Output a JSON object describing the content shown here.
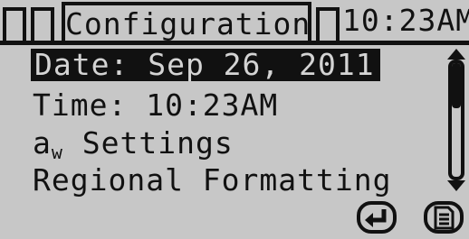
{
  "header": {
    "title": "Configuration",
    "clock": "10:23AM"
  },
  "menu": {
    "items": [
      {
        "label": "Date: Sep 26, 2011",
        "selected": true
      },
      {
        "label": "Time: 10:23AM",
        "selected": false
      },
      {
        "label_prefix": "a",
        "label_sub": "w",
        "label_suffix": " Settings",
        "selected": false
      },
      {
        "label": "Regional Formatting",
        "selected": false
      }
    ]
  },
  "scrollbar": {
    "position_fraction": 0.0
  },
  "icons": {
    "status_left": "empty-status-box",
    "status_right": "empty-status-box",
    "enter": "enter-arrow-icon",
    "log": "document-log-icon"
  },
  "colors": {
    "background": "#c7c7c7",
    "foreground": "#111111",
    "selected_text": "#d4d4d4"
  }
}
